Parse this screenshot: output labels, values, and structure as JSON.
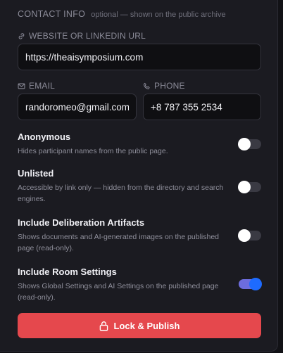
{
  "contact": {
    "title": "CONTACT INFO",
    "note": "optional — shown on the public archive",
    "website": {
      "label": "WEBSITE OR LINKEDIN URL",
      "value": "https://theaisymposium.com",
      "icon": "link-icon"
    },
    "email": {
      "label": "EMAIL",
      "value": "randoromeo@gmail.com",
      "icon": "mail-icon"
    },
    "phone": {
      "label": "PHONE",
      "value": "+8 787 355 2534",
      "icon": "phone-icon"
    }
  },
  "settings": [
    {
      "title": "Anonymous",
      "description": "Hides participant names from the public page.",
      "enabled": false
    },
    {
      "title": "Unlisted",
      "description": "Accessible by link only — hidden from the directory and search engines.",
      "enabled": false
    },
    {
      "title": "Include Deliberation Artifacts",
      "description": "Shows documents and AI-generated images on the published page (read-only).",
      "enabled": false
    },
    {
      "title": "Include Room Settings",
      "description": "Shows Global Settings and AI Settings on the published page (read-only).",
      "enabled": true
    }
  ],
  "publish_button": {
    "label": "Lock & Publish",
    "icon": "lock-icon"
  },
  "colors": {
    "accent_red": "#e5484d",
    "toggle_on_track": "#6d6dde",
    "toggle_on_knob": "#1e6bff",
    "panel_bg": "#1b1b21"
  }
}
